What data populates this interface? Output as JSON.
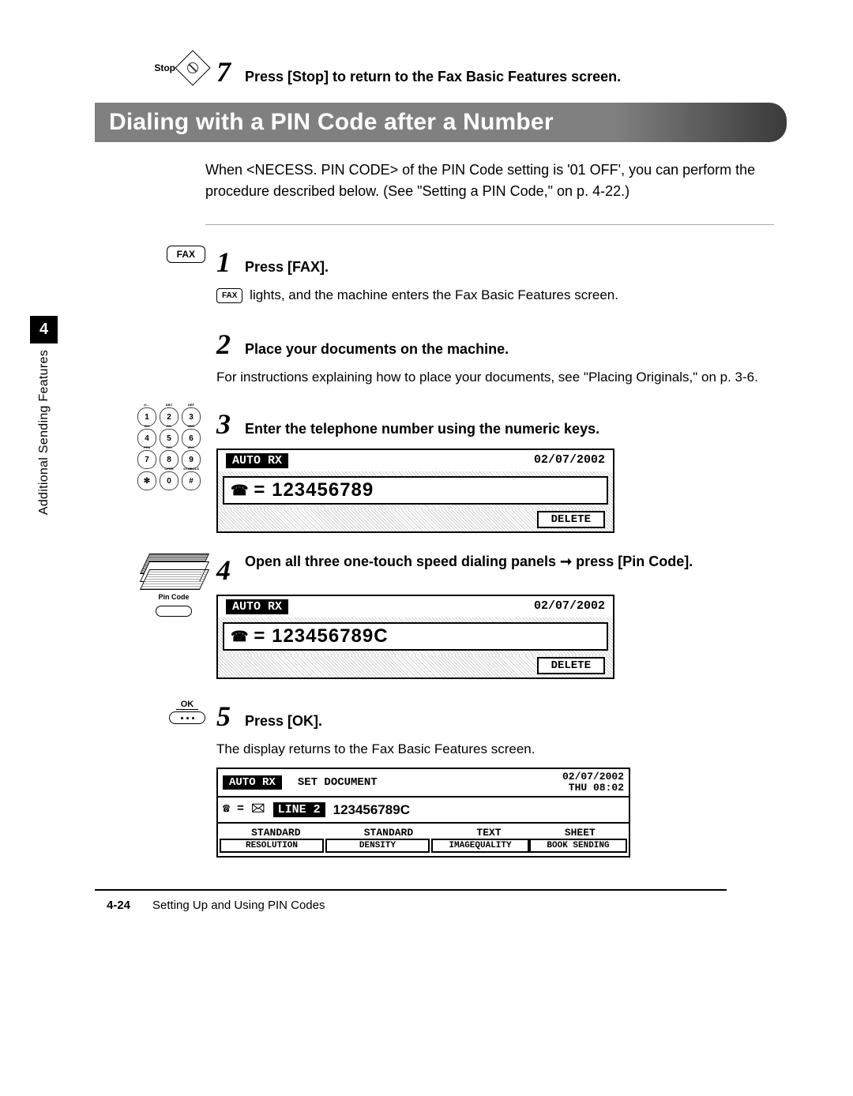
{
  "step7": {
    "stop_label": "Stop",
    "num": "7",
    "text": "Press [Stop] to return to the Fax Basic Features screen."
  },
  "section_title": "Dialing with a PIN Code after a Number",
  "intro": "When <NECESS. PIN CODE> of the PIN Code setting is '01 OFF', you can perform the procedure described below. (See \"Setting a PIN Code,\" on p. 4-22.)",
  "step1": {
    "key_label": "FAX",
    "num": "1",
    "head": "Press [FAX].",
    "sub_prefix_key": "FAX",
    "sub": " lights, and the machine enters the Fax Basic Features screen."
  },
  "step2": {
    "num": "2",
    "head": "Place your documents on the machine.",
    "sub": "For instructions explaining how to place your documents, see \"Placing Originals,\" on p. 3-6."
  },
  "step3": {
    "num": "3",
    "head": "Enter the telephone number using the numeric keys.",
    "lcd": {
      "status": "AUTO RX",
      "date": "02/07/2002",
      "number": "= 123456789",
      "delete": "DELETE"
    },
    "keypad_sups": [
      "@.-_",
      "ABC",
      "DEF",
      "GHI",
      "JKL",
      "MNO",
      "PRS",
      "TUV",
      "WXY",
      "",
      "OPER",
      "SYMBOLS"
    ]
  },
  "step4": {
    "num": "4",
    "head_a": "Open all three one-touch speed dialing panels ",
    "head_b": " press [Pin Code].",
    "pin_label": "Pin Code",
    "lcd": {
      "status": "AUTO RX",
      "date": "02/07/2002",
      "number": "= 123456789C",
      "delete": "DELETE"
    }
  },
  "step5": {
    "ok_label": "OK",
    "num": "5",
    "head": "Press [OK].",
    "sub": "The display returns to the Fax Basic Features screen.",
    "lcd": {
      "status": "AUTO RX",
      "set": "SET DOCUMENT",
      "date": "02/07/2002",
      "time": "THU 08:02",
      "line": "LINE 2",
      "number": "123456789C",
      "row3": [
        "STANDARD",
        "STANDARD",
        "TEXT",
        "SHEET"
      ],
      "row4": [
        "RESOLUTION",
        "DENSITY",
        "IMAGEQUALITY",
        "BOOK SENDING"
      ]
    }
  },
  "side": {
    "chapter": "4",
    "label": "Additional Sending Features"
  },
  "footer": {
    "page": "4-24",
    "title": "Setting Up and Using PIN Codes"
  }
}
